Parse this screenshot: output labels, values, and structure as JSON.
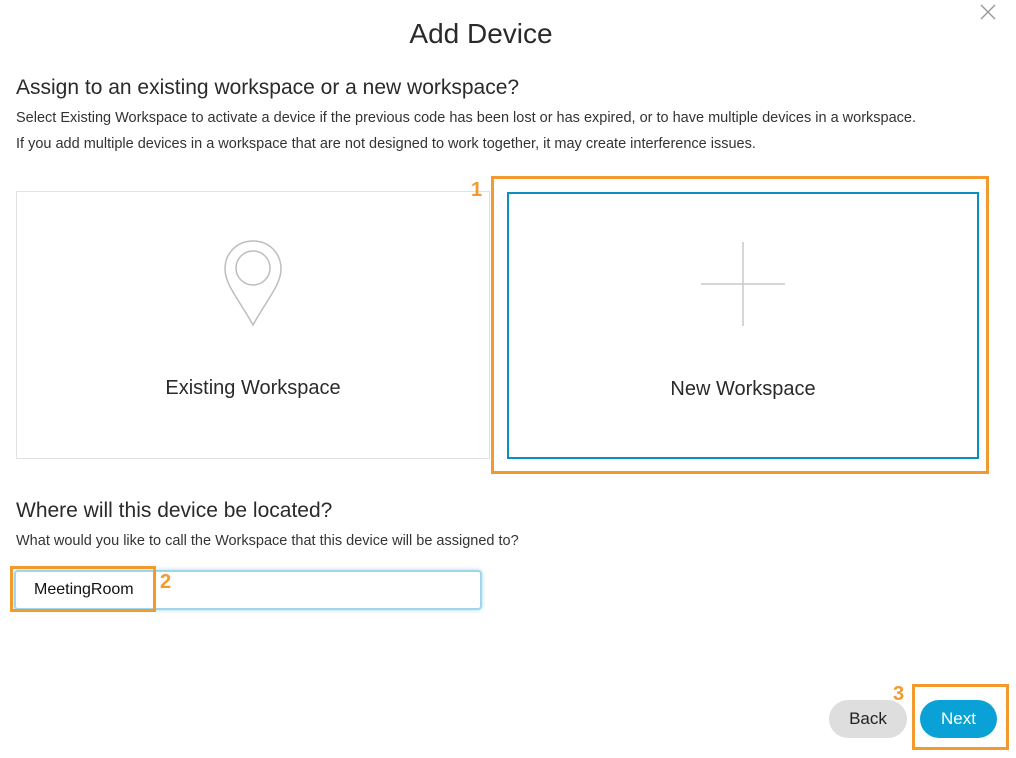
{
  "dialog": {
    "title": "Add Device",
    "close_icon": "close-icon"
  },
  "assign_section": {
    "heading": "Assign to an existing workspace or a new workspace?",
    "description_line1": "Select Existing Workspace to activate a device if the previous code has been lost or has expired, or to have multiple devices in a workspace.",
    "description_line2": "If you add multiple devices in a workspace that are not designed to work together, it may create interference issues."
  },
  "options": {
    "existing": {
      "label": "Existing Workspace",
      "icon": "location-pin-icon"
    },
    "new": {
      "label": "New Workspace",
      "icon": "plus-icon",
      "selected": true
    }
  },
  "location_section": {
    "heading": "Where will this device be located?",
    "description": "What would you like to call the Workspace that this device will be assigned to?",
    "workspace_name_value": "MeetingRoom"
  },
  "footer": {
    "back_label": "Back",
    "next_label": "Next"
  },
  "callouts": {
    "step1": "1",
    "step2": "2",
    "step3": "3"
  },
  "colors": {
    "accent": "#0aa2d6",
    "selected_border": "#0a8fc2",
    "callout": "#f29a2e"
  }
}
